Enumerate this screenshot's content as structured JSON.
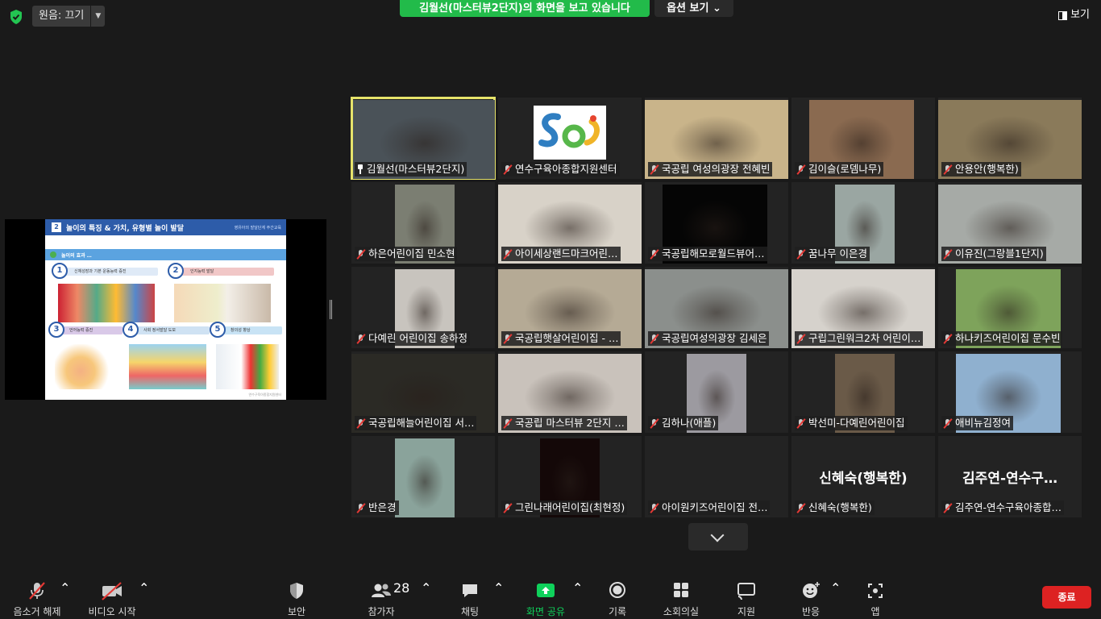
{
  "top": {
    "original_sound_label": "원음: 끄기",
    "viewing_banner": "김월선(마스터뷰2단지)의 화면을 보고 있습니다",
    "view_options": "옵션 보기 ⌄",
    "view_label": "보기"
  },
  "shared_slide": {
    "number": "2",
    "title": "놀이의 특징 & 가치, 유형별 놀이 발달",
    "subtitle": "영유아의 발달단계 주간교육",
    "section": "놀이의 효과 …",
    "cards": [
      {
        "num": "1",
        "label": "신체성장과 기본 운동능력 증진"
      },
      {
        "num": "2",
        "label": "인지능력 발달"
      },
      {
        "num": "3",
        "label": "언어능력 증진"
      },
      {
        "num": "4",
        "label": "사회 정서발달 도모"
      },
      {
        "num": "5",
        "label": "창의성 향상"
      }
    ],
    "footer": "연수구육아종합지원센터"
  },
  "gallery": {
    "tiles": [
      {
        "name": "김월선(마스터뷰2단지)",
        "active": true,
        "pinned": true,
        "bg": "#4a5258"
      },
      {
        "name": "연수구육아종합지원센터",
        "bg": "#ffffff",
        "logo": true
      },
      {
        "name": "국공립 여성의광장 전혜빈",
        "bg": "#c9b48a"
      },
      {
        "name": "김이슬(로뎀나무)",
        "bg": "#8a6a50"
      },
      {
        "name": "안용안(행복한)",
        "bg": "#8a7a5a"
      },
      {
        "name": "하은어린이집 민소현",
        "bg": "#7b7e72"
      },
      {
        "name": "아이세상랜드마크어린…",
        "bg": "#d8d2c8"
      },
      {
        "name": "국공립해모로월드뷰어…",
        "bg": "#050505"
      },
      {
        "name": "꿈나무 이은경",
        "bg": "#9aa6a2"
      },
      {
        "name": "이유진(그랑블1단지)",
        "bg": "#a6aaa6"
      },
      {
        "name": "다예린 어린이집 송하정",
        "bg": "#c8c4be"
      },
      {
        "name": "국공립햇살어린이집 - …",
        "bg": "#b5aa95"
      },
      {
        "name": "국공립여성의광장 김세은",
        "bg": "#8b8f8c"
      },
      {
        "name": "구립그린워크2차 어린이…",
        "bg": "#d6d2cc"
      },
      {
        "name": "하나키즈어린이집 문수빈",
        "bg": "#7ea35b"
      },
      {
        "name": "국공립해늘어린이집 서…",
        "bg": "#2b2a25"
      },
      {
        "name": "국공립 마스터뷰 2단지 …",
        "bg": "#c9c2bb"
      },
      {
        "name": "김하나(애플)",
        "bg": "#9c9aa0"
      },
      {
        "name": "박선미-다예린어린이집",
        "bg": "#6a5a48"
      },
      {
        "name": "애비뉴김정여",
        "bg": "#8fb0cf"
      },
      {
        "name": "반은경",
        "bg": "#8aa39b"
      },
      {
        "name": "그린나래어린이집(최현정)",
        "bg": "#140808"
      },
      {
        "name": "아이원키즈어린이집 전…",
        "bg": "#232323",
        "novideo": true
      },
      {
        "name": "신혜숙(행복한)",
        "bg": "#232323",
        "novideo": true,
        "bigname": "신혜숙(행복한)"
      },
      {
        "name": "김주연-연수구육아종합…",
        "bg": "#232323",
        "novideo": true,
        "bigname": "김주연-연수구…"
      }
    ]
  },
  "toolbar": {
    "unmute": "음소거 해제",
    "start_video": "비디오 시작",
    "security": "보안",
    "participants": "참가자",
    "participants_count": "28",
    "chat": "채팅",
    "share_screen": "화면 공유",
    "record": "기록",
    "breakout": "소회의실",
    "support": "지원",
    "reactions": "반응",
    "apps": "앱",
    "end": "종료"
  },
  "colors": {
    "banner_green": "#22bb4a",
    "active_speaker": "#e6e36a",
    "end_red": "#dd2222",
    "share_green": "#0fd15b"
  }
}
